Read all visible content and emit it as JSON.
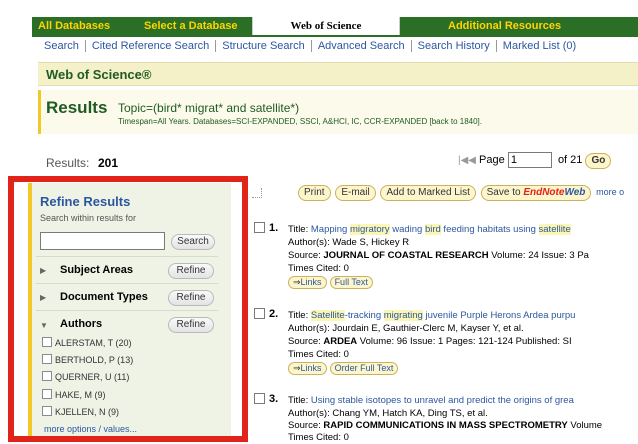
{
  "tabs": [
    {
      "label": "All Databases"
    },
    {
      "label": "Select a Database"
    },
    {
      "label": "Web of Science"
    },
    {
      "label": "Additional Resources"
    }
  ],
  "subnav": [
    "Search",
    "Cited Reference Search",
    "Structure Search",
    "Advanced Search",
    "Search History",
    "Marked List (0)"
  ],
  "section_title": "Web of Science®",
  "results": {
    "heading": "Results",
    "topic": "Topic=(bird* migrat* and satellite*)",
    "timespan": "Timespan=All Years. Databases=SCI-EXPANDED, SSCI, A&HCI, IC, CCR-EXPANDED [back to 1840].",
    "count_label": "Results:",
    "count": "201",
    "page_label": "Page",
    "page_value": "1",
    "page_of": "of 21",
    "go_label": "Go"
  },
  "refine": {
    "title": "Refine Results",
    "search_label": "Search within results for",
    "search_button": "Search",
    "refine_label": "Refine",
    "facets": [
      "Subject Areas",
      "Document Types",
      "Authors"
    ],
    "authors": [
      "ALERSTAM, T (20)",
      "BERTHOLD, P (13)",
      "QUERNER, U (11)",
      "HAKE, M (9)",
      "KJELLEN, N (9)"
    ],
    "more_link": "more options / values..."
  },
  "actions": {
    "print": "Print",
    "email": "E-mail",
    "marked": "Add to Marked List",
    "save_to": "Save to",
    "endnote": "EndNote",
    "web": "Web",
    "more": "more o"
  },
  "records": [
    {
      "num": "1.",
      "title_pre": "Title: ",
      "title": "Mapping migratory wading bird feeding habitats using satellite",
      "authors": "Author(s): Wade S, Hickey R",
      "source_pre": "Source: ",
      "source": "JOURNAL OF COASTAL RESEARCH",
      "source_post": "  Volume: 24   Issue: 3   Pa",
      "cited": "Times Cited: 0",
      "btn1": "Links",
      "btn2": "Full Text"
    },
    {
      "num": "2.",
      "title_pre": "Title: ",
      "title": "Satellite-tracking migrating juvenile Purple Herons Ardea purpu",
      "authors": "Author(s): Jourdain E, Gauthier-Clerc M, Kayser Y, et al.",
      "source_pre": "Source: ",
      "source": "ARDEA",
      "source_post": "  Volume: 96   Issue: 1   Pages: 121-124   Published: SI",
      "cited": "Times Cited: 0",
      "btn1": "Links",
      "btn2": "Order Full Text"
    },
    {
      "num": "3.",
      "title_pre": "Title: ",
      "title": "Using stable isotopes to unravel and predict the origins of grea",
      "authors": "Author(s): Chang YM, Hatch KA, Ding TS, et al.",
      "source_pre": "Source: ",
      "source": "RAPID COMMUNICATIONS IN MASS SPECTROMETRY",
      "source_post": "  Volume",
      "cited": "Times Cited: 0"
    }
  ]
}
